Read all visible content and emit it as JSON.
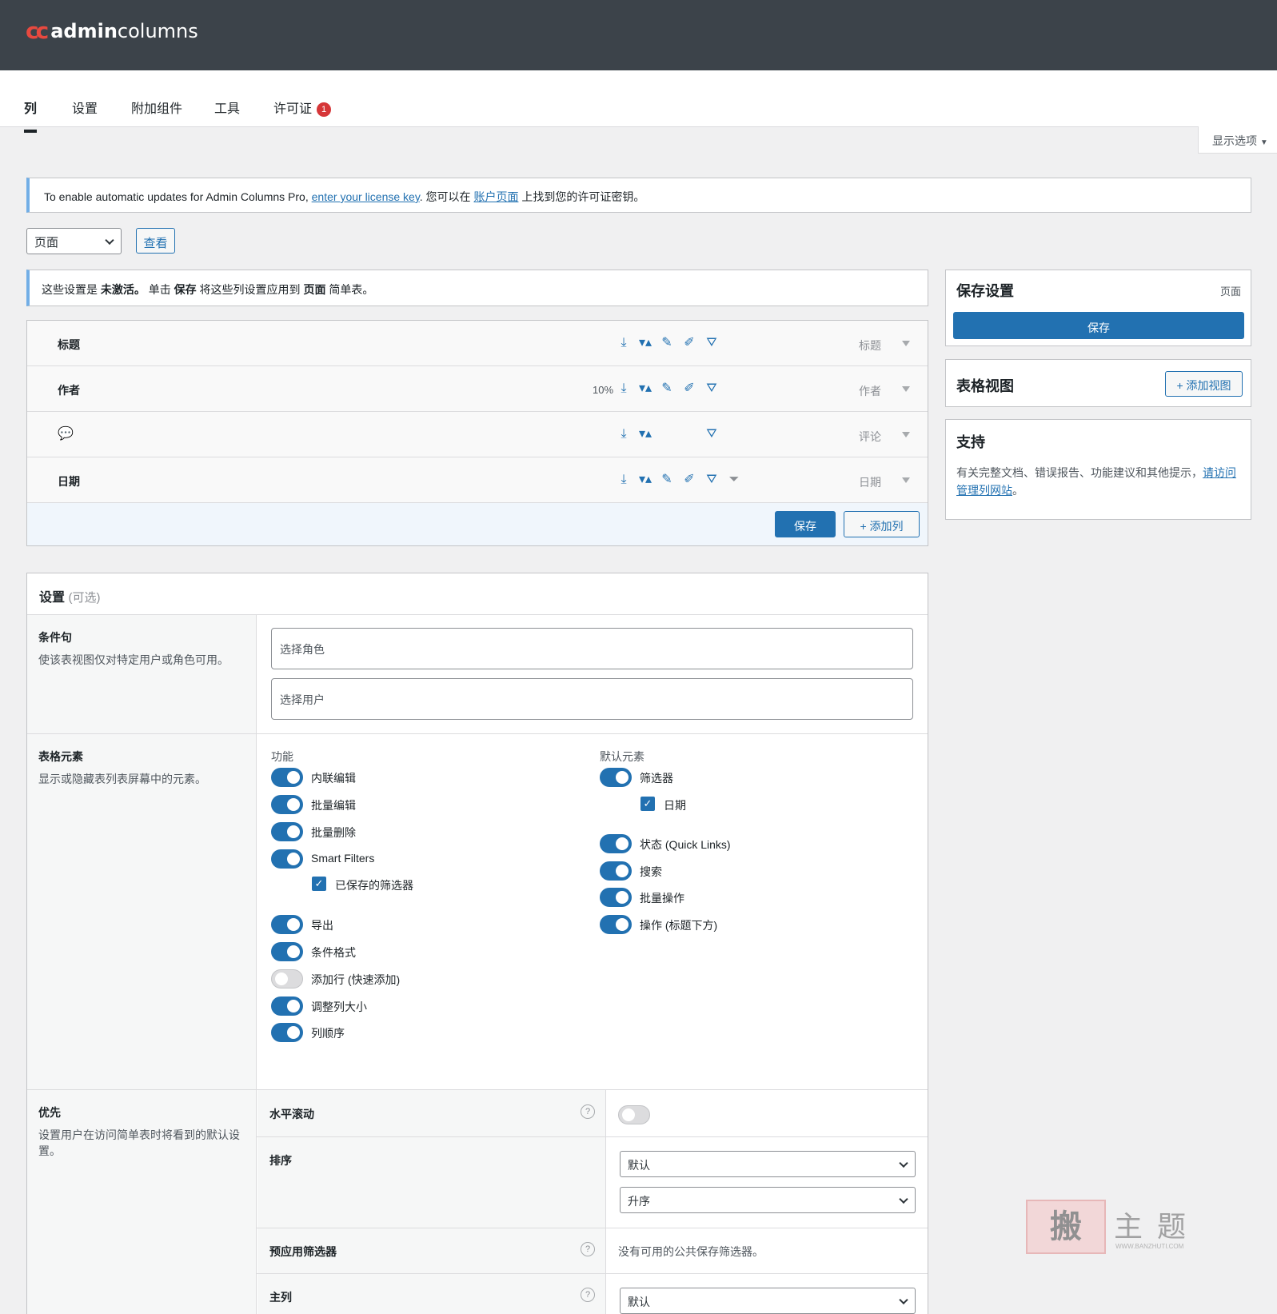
{
  "brand": {
    "mark": "cc",
    "name_bold": "admin",
    "name_rest": "columns"
  },
  "tabs": [
    {
      "label": "列"
    },
    {
      "label": "设置"
    },
    {
      "label": "附加组件"
    },
    {
      "label": "工具"
    },
    {
      "label": "许可证",
      "badge": "1"
    }
  ],
  "screen_options": "显示选项",
  "license_notice": {
    "prefix": "To enable automatic updates for Admin Columns Pro, ",
    "link1": "enter your license key",
    "middle": ". 您可以在 ",
    "link2": "账户页面",
    "suffix": " 上找到您的许可证密钥。"
  },
  "list_screen_select": {
    "value": "页面"
  },
  "view_button": "查看",
  "inactive_notice": {
    "p1": "这些设置是 ",
    "b1": "未激活。",
    "p2": " 单击 ",
    "b2": "保存",
    "p3": " 将这些列设置应用到 ",
    "b3": "页面",
    "p4": " 简单表。"
  },
  "columns": [
    {
      "label": "标题",
      "type": "标题",
      "width": ""
    },
    {
      "label": "作者",
      "type": "作者",
      "width": "10%"
    },
    {
      "label": "",
      "type": "评论",
      "width": ""
    },
    {
      "label": "日期",
      "type": "日期",
      "width": ""
    }
  ],
  "columns_footer": {
    "save": "保存",
    "add": "+ 添加列"
  },
  "sidebar": {
    "save_box": {
      "title": "保存设置",
      "context": "页面",
      "button": "保存"
    },
    "views_box": {
      "title": "表格视图",
      "button": "+ 添加视图"
    },
    "support_box": {
      "title": "支持",
      "text": "有关完整文档、错误报告、功能建议和其他提示，",
      "link": "请访问管理列网站",
      "end": "。"
    }
  },
  "settings": {
    "title": "设置",
    "optional": "(可选)",
    "conditionals": {
      "title": "条件句",
      "desc": "使该表视图仅对特定用户或角色可用。",
      "roles_placeholder": "选择角色",
      "users_placeholder": "选择用户"
    },
    "elements": {
      "title": "表格元素",
      "desc": "显示或隐藏表列表屏幕中的元素。",
      "features_label": "功能",
      "defaults_label": "默认元素",
      "features": [
        {
          "label": "内联编辑",
          "on": true
        },
        {
          "label": "批量编辑",
          "on": true
        },
        {
          "label": "批量删除",
          "on": true
        },
        {
          "label": "Smart Filters",
          "on": true
        },
        {
          "label": "已保存的筛选器",
          "checkbox": true
        },
        {
          "label": "导出",
          "on": true
        },
        {
          "label": "条件格式",
          "on": true
        },
        {
          "label": "添加行 (快速添加)",
          "on": false
        },
        {
          "label": "调整列大小",
          "on": true
        },
        {
          "label": "列顺序",
          "on": true
        }
      ],
      "defaults": [
        {
          "label": "筛选器",
          "on": true
        },
        {
          "label": "日期",
          "checkbox": true
        },
        {
          "label": "状态 (Quick Links)",
          "on": true
        },
        {
          "label": "搜索",
          "on": true
        },
        {
          "label": "批量操作",
          "on": true
        },
        {
          "label": "操作 (标题下方)",
          "on": true
        }
      ]
    },
    "preferences": {
      "title": "优先",
      "desc": "设置用户在访问简单表时将看到的默认设置。",
      "horizontal_scroll": "水平滚动",
      "sorting": "排序",
      "sorting_value": "默认",
      "order_value": "升序",
      "preapply_filter": "预应用筛选器",
      "no_filters": "没有可用的公共保存筛选器。",
      "primary_column": "主列",
      "primary_value": "默认"
    }
  },
  "watermark": {
    "box": "搬",
    "text": "主题",
    "sub": "WWW.BANZHUTI.COM"
  }
}
